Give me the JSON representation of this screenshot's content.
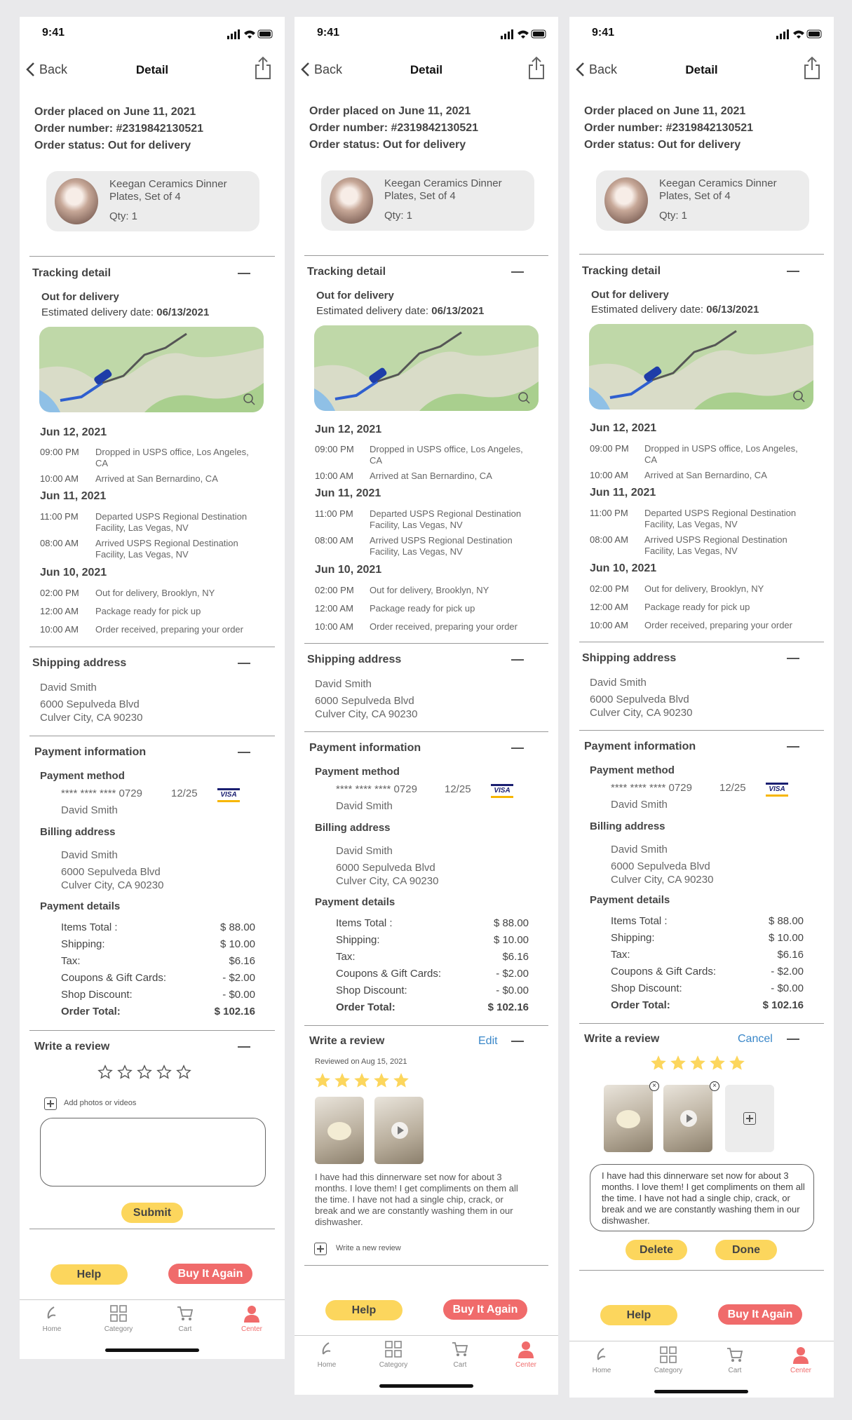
{
  "status_bar": {
    "time": "9:41"
  },
  "nav": {
    "back": "Back",
    "title": "Detail"
  },
  "order": {
    "placed": "Order placed on June 11, 2021",
    "number": "Order number: #2319842130521",
    "status": "Order status: Out for delivery"
  },
  "product": {
    "name": "Keegan Ceramics Dinner Plates, Set of 4",
    "qty": "Qty: 1"
  },
  "tracking": {
    "header": "Tracking detail",
    "status": "Out for delivery",
    "est_label": "Estimated delivery date: ",
    "est_date": "06/13/2021",
    "days": [
      {
        "date": "Jun 12, 2021",
        "events": [
          {
            "time": "09:00 PM",
            "text": "Dropped in USPS office, Los Angeles, CA"
          },
          {
            "time": "10:00 AM",
            "text": "Arrived at San Bernardino, CA"
          }
        ]
      },
      {
        "date": "Jun 11, 2021",
        "events": [
          {
            "time": "11:00 PM",
            "text": "Departed USPS Regional Destination Facility, Las Vegas, NV"
          },
          {
            "time": "08:00 AM",
            "text": "Arrived USPS Regional Destination Facility, Las Vegas, NV"
          }
        ]
      },
      {
        "date": "Jun 10, 2021",
        "events": [
          {
            "time": "02:00 PM",
            "text": "Out for delivery, Brooklyn, NY"
          },
          {
            "time": "12:00 AM",
            "text": "Package ready for pick up"
          },
          {
            "time": "10:00 AM",
            "text": "Order received, preparing your order"
          }
        ]
      }
    ]
  },
  "shipping": {
    "header": "Shipping address",
    "name": "David Smith",
    "line1": "6000 Sepulveda Blvd",
    "line2": "Culver City, CA 90230"
  },
  "payment": {
    "header": "Payment information",
    "method_label": "Payment method",
    "card_number": "**** **** **** 0729",
    "card_exp": "12/25",
    "card_brand": "VISA",
    "card_holder": "David Smith",
    "billing_label": "Billing address",
    "billing_name": "David Smith",
    "billing_line1": "6000 Sepulveda Blvd",
    "billing_line2": "Culver City, CA 90230",
    "details_label": "Payment details",
    "lines": [
      {
        "label": "Items Total :",
        "value": "$ 88.00"
      },
      {
        "label": "Shipping:",
        "value": "$ 10.00"
      },
      {
        "label": "Tax:",
        "value": "$6.16"
      },
      {
        "label": "Coupons & Gift Cards:",
        "value": "- $2.00"
      },
      {
        "label": "Shop Discount:",
        "value": "- $0.00"
      }
    ],
    "total_label": "Order Total:",
    "total_value": "$ 102.16"
  },
  "review": {
    "header": "Write a review",
    "edit": "Edit",
    "cancel": "Cancel",
    "add_photos": "Add photos or videos",
    "submit": "Submit",
    "reviewed_on": "Reviewed on Aug 15, 2021",
    "text": "I have had this dinnerware set now for about 3 months. I love them! I get compliments on them all the time. I have not had a single chip, crack, or break and we are constantly washing them in our dishwasher.",
    "write_new": "Write a new review",
    "delete": "Delete",
    "done": "Done",
    "rating_screen1": 0,
    "rating_screen2": 5,
    "rating_screen3": 5
  },
  "actions": {
    "help": "Help",
    "buy_again": "Buy It Again"
  },
  "tabs": {
    "home": "Home",
    "category": "Category",
    "cart": "Cart",
    "center": "Center"
  },
  "colors": {
    "accent_yellow": "#fcd65d",
    "accent_red": "#f06b6b",
    "link_blue": "#3a87c9",
    "star_gold": "#fcd65d"
  }
}
